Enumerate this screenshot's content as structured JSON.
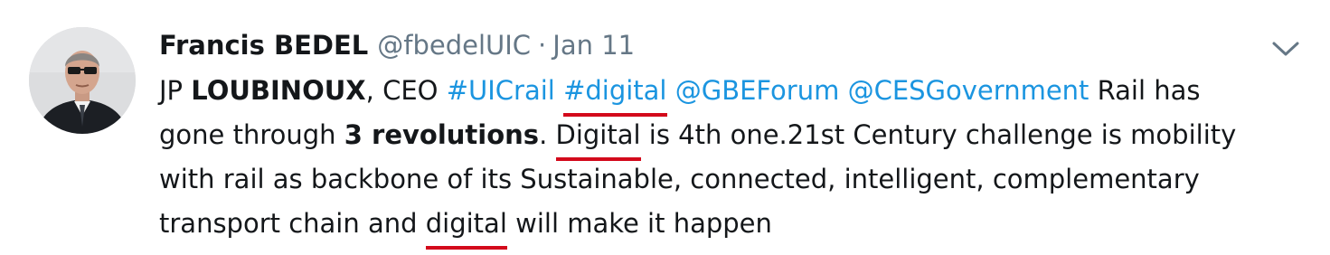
{
  "tweet": {
    "author_name": "Francis BEDEL",
    "author_handle": "@fbedelUIC",
    "separator": "·",
    "date": "Jan 11",
    "menu_icon": "chevron-down-icon",
    "body": {
      "l1_prefix": "JP ",
      "l1_bold_name": "LOUBINOUX",
      "l1_role": ", CEO ",
      "hashtag_1": "#UICrail",
      "hashtag_2": "#digital",
      "mention_1": "@GBEForum",
      "mention_2": "@CESGovernment",
      "l1_suffix": " Rail has",
      "l2_prefix": "gone through ",
      "l2_bold": "3 revolutions",
      "l2_period": ". ",
      "l2_word_digital": "Digital",
      "l2_suffix": " is 4th one.21st Century challenge is mobility",
      "l3_text": "with rail as backbone of its Sustainable, connected, intelligent, complementary",
      "l4_prefix": "transport chain and ",
      "l4_word_digital": "digital",
      "l4_suffix": " will make it happen"
    }
  },
  "colors": {
    "link": "#1b95e0",
    "muted": "#657786",
    "text": "#14171a",
    "underline_annotation": "#d3091b"
  }
}
